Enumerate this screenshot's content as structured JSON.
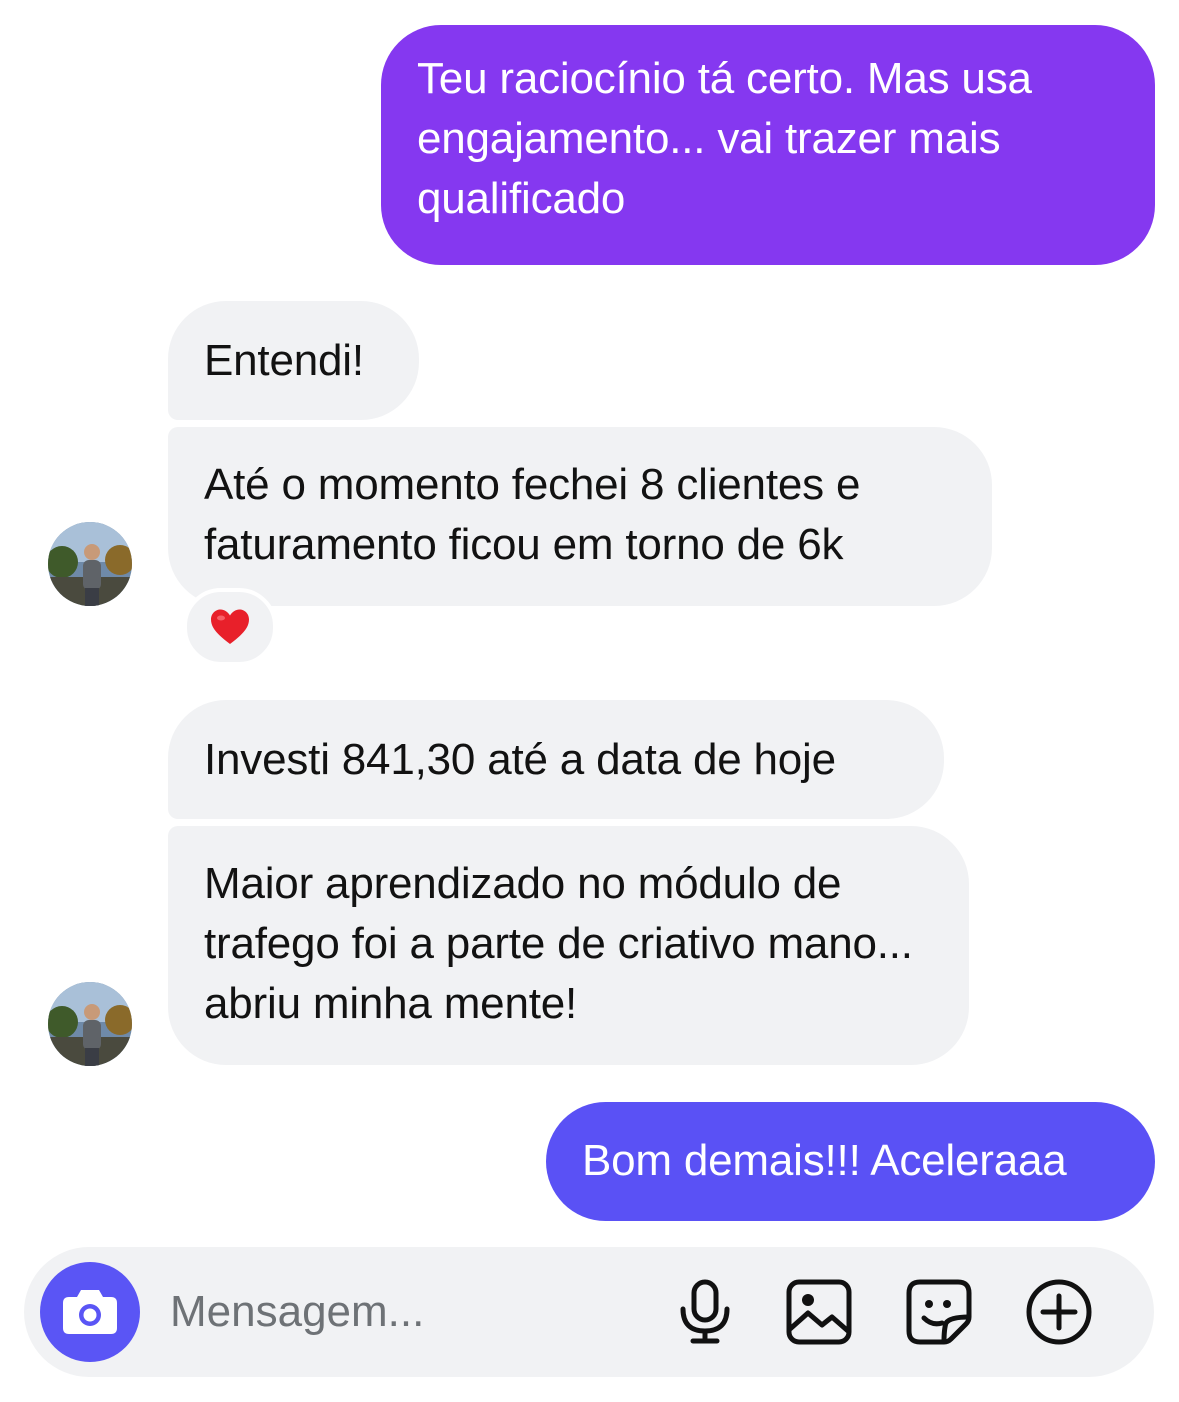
{
  "colors": {
    "outgoing_purple": "#8538f0",
    "outgoing_blue": "#5a51f5",
    "incoming_bg": "#f1f2f4",
    "reaction_heart": "#e8202a"
  },
  "messages": [
    {
      "from": "me",
      "text": "Teu raciocínio tá certo. Mas usa engajamento... vai trazer mais qualificado"
    },
    {
      "from": "contact",
      "text": "Entendi!"
    },
    {
      "from": "contact",
      "text": "Até o momento fechei 8 clientes e faturamento ficou em torno de 6k",
      "reaction": "❤️"
    },
    {
      "from": "contact",
      "text": "Investi 841,30 até a data de hoje"
    },
    {
      "from": "contact",
      "text": "Maior aprendizado no módulo de trafego foi a parte de criativo mano... abriu minha mente!"
    },
    {
      "from": "me",
      "text": "Bom demais!!! Aceleraaa"
    }
  ],
  "composer": {
    "placeholder": "Mensagem...",
    "icons": [
      "camera-icon",
      "microphone-icon",
      "image-icon",
      "sticker-icon",
      "plus-icon"
    ]
  }
}
